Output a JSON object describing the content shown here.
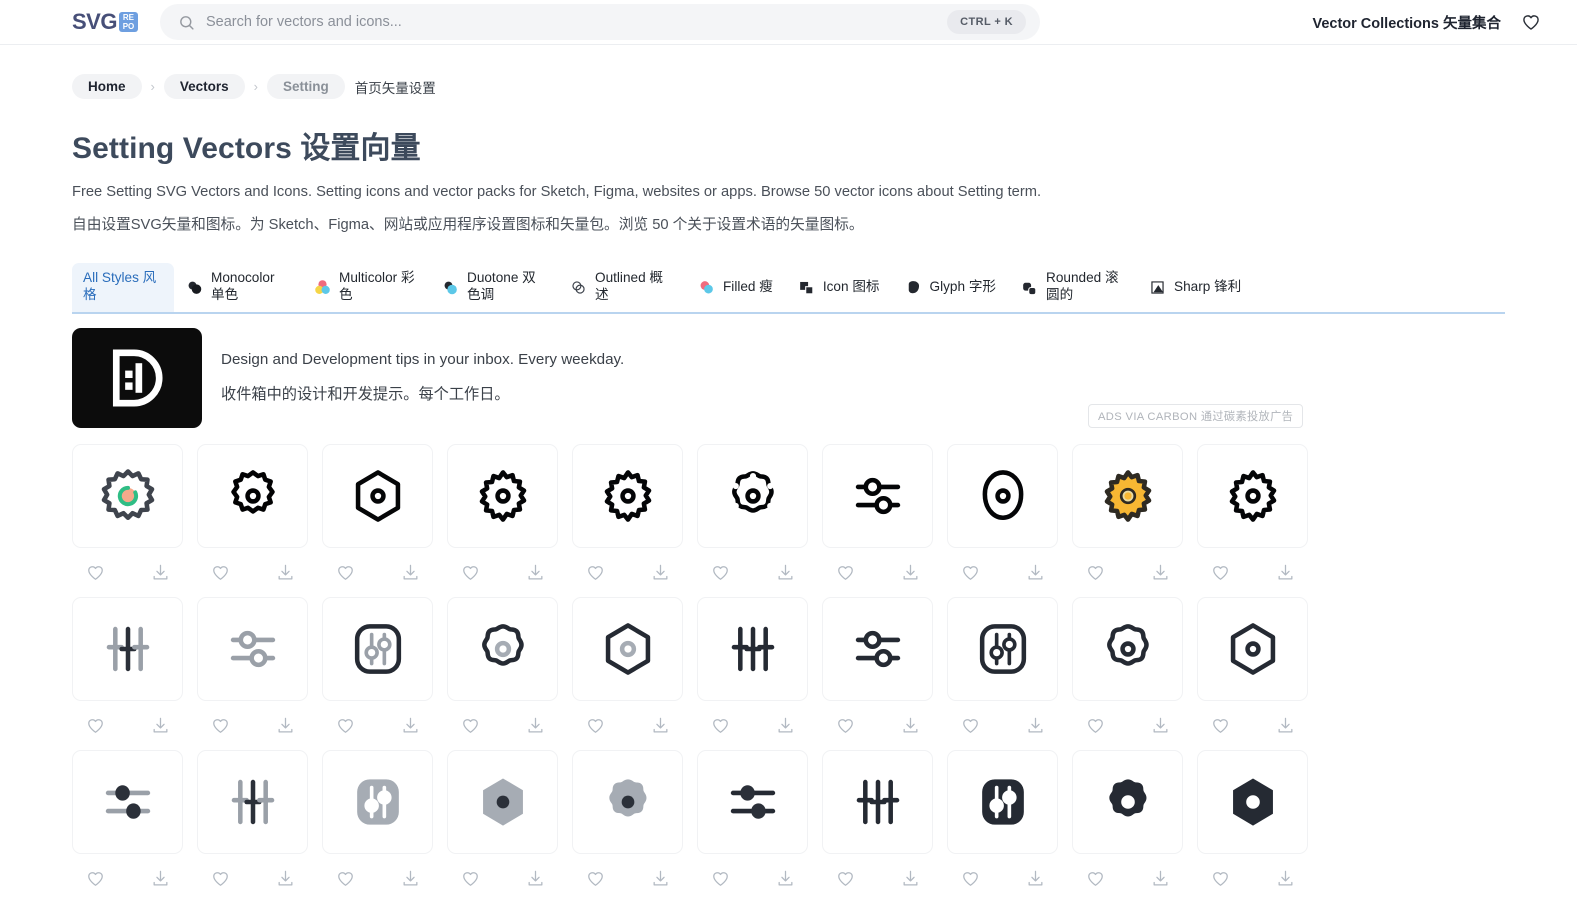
{
  "header": {
    "logo_text": "SVG",
    "logo_badge_top": "RE",
    "logo_badge_bottom": "PO",
    "search_placeholder": "Search for vectors and icons...",
    "search_value": "",
    "shortcut": "CTRL + K",
    "collections_label": "Vector Collections 矢量集合",
    "favorites_icon": "heart-icon",
    "search_icon": "search-icon"
  },
  "breadcrumb": {
    "items": [
      {
        "label": "Home",
        "muted": false
      },
      {
        "label": "Vectors",
        "muted": false
      },
      {
        "label": "Setting",
        "muted": true
      }
    ],
    "separator": "›",
    "trailing_text": "首页矢量设置"
  },
  "page": {
    "title": "Setting Vectors  设置向量",
    "description_en": "Free Setting SVG Vectors and Icons. Setting icons and vector packs for Sketch, Figma, websites or apps. Browse 50 vector icons about Setting term.",
    "description_zh": "自由设置SVG矢量和图标。为 Sketch、Figma、网站或应用程序设置图标和矢量包。浏览 50 个关于设置术语的矢量图标。"
  },
  "tabs": [
    {
      "label": "All Styles 风格",
      "icon": "none",
      "active": true
    },
    {
      "label": "Monocolor 单色",
      "icon": "two-circles-black-icon",
      "active": false
    },
    {
      "label": "Multicolor 彩色",
      "icon": "three-circles-color-icon",
      "active": false
    },
    {
      "label": "Duotone 双色调",
      "icon": "two-circles-duotone-icon",
      "active": false
    },
    {
      "label": "Outlined 概述",
      "icon": "two-circles-outline-icon",
      "active": false
    },
    {
      "label": "Filled 瘦",
      "icon": "two-circles-filled-icon",
      "active": false
    },
    {
      "label": "Icon 图标",
      "icon": "two-squares-icon",
      "active": false
    },
    {
      "label": "Glyph 字形",
      "icon": "blob-glyph-icon",
      "active": false
    },
    {
      "label": "Rounded 滚圆的",
      "icon": "rounded-squares-icon",
      "active": false
    },
    {
      "label": "Sharp 锋利",
      "icon": "sharp-triangle-icon",
      "active": false
    }
  ],
  "ad": {
    "logo_alt": "design-and-development-logo",
    "line_en": "Design and Development tips in your inbox. Every weekday.",
    "line_zh": "收件箱中的设计和开发提示。每个工作日。",
    "badge": "ADS VIA CARBON 通过碳素投放广告"
  },
  "grid": {
    "like_icon": "heart-icon",
    "download_icon": "download-icon",
    "items": [
      {
        "name": "gear-multicolor-badge",
        "shape": "burst-gear",
        "stroke": "#3f444d",
        "fill": "none",
        "center": "multicolor"
      },
      {
        "name": "gear-small-outline",
        "shape": "flower-gear",
        "stroke": "#020203",
        "fill": "none",
        "center": "ring-dark"
      },
      {
        "name": "hexagon-nut-outline",
        "shape": "hexagon",
        "stroke": "#050607",
        "fill": "none",
        "center": "ring-dark"
      },
      {
        "name": "gear-six-tooth-outline",
        "shape": "gear6",
        "stroke": "#040507",
        "fill": "none",
        "center": "ring-dark"
      },
      {
        "name": "gear-six-tooth-outline-2",
        "shape": "gear6",
        "stroke": "#040507",
        "fill": "none",
        "center": "ring-dark"
      },
      {
        "name": "gear-dotted-outline",
        "shape": "gear-dots",
        "stroke": "#040507",
        "fill": "none",
        "center": "ring-dark"
      },
      {
        "name": "sliders-horizontal-outline",
        "shape": "sliders-h",
        "stroke": "#040507",
        "fill": "none",
        "center": "none"
      },
      {
        "name": "nut-circle-outline",
        "shape": "blob",
        "stroke": "#040507",
        "fill": "none",
        "center": "ring-dark"
      },
      {
        "name": "gear-yellow-filled",
        "shape": "gear6",
        "stroke": "#2e2a22",
        "fill": "#f7b733",
        "center": "ring-yellow"
      },
      {
        "name": "gear-six-tooth-bold",
        "shape": "gear6",
        "stroke": "#040507",
        "fill": "none",
        "center": "ring-dark"
      },
      {
        "name": "sliders-vertical-duotone",
        "shape": "sliders-v",
        "stroke": "#9aa0a8",
        "fill": "none",
        "center": "duo"
      },
      {
        "name": "sliders-horizontal-duotone",
        "shape": "sliders-h",
        "stroke": "#9aa0a8",
        "fill": "none",
        "center": "duo"
      },
      {
        "name": "settings-panel-rounded",
        "shape": "panel-sliders",
        "stroke": "#252a33",
        "fill": "none",
        "center": "duo"
      },
      {
        "name": "gear-soft-outline-gray-center",
        "shape": "gear6soft",
        "stroke": "#252a33",
        "fill": "none",
        "center": "ring-gray"
      },
      {
        "name": "hexagon-gray-center",
        "shape": "hexagon",
        "stroke": "#252a33",
        "fill": "none",
        "center": "ring-gray"
      },
      {
        "name": "sliders-vertical-outline",
        "shape": "sliders-v",
        "stroke": "#252a33",
        "fill": "none",
        "center": "mono"
      },
      {
        "name": "sliders-horizontal-outline-2",
        "shape": "sliders-h",
        "stroke": "#252a33",
        "fill": "none",
        "center": "mono"
      },
      {
        "name": "settings-panel-rounded-2",
        "shape": "panel-sliders",
        "stroke": "#252a33",
        "fill": "none",
        "center": "mono"
      },
      {
        "name": "gear-soft-outline",
        "shape": "gear6soft",
        "stroke": "#252a33",
        "fill": "none",
        "center": "ring-dark"
      },
      {
        "name": "hexagon-nut-outline-2",
        "shape": "hexagon",
        "stroke": "#252a33",
        "fill": "none",
        "center": "ring-dark"
      },
      {
        "name": "sliders-horizontal-filled-duotone",
        "shape": "sliders-h",
        "stroke": "#9aa0a8",
        "fill": "solid",
        "center": "duo"
      },
      {
        "name": "sliders-vertical-filled-duotone",
        "shape": "sliders-v",
        "stroke": "#9aa0a8",
        "fill": "solid",
        "center": "duo"
      },
      {
        "name": "settings-panel-filled-gray",
        "shape": "panel-sliders",
        "stroke": "#a6acb4",
        "fill": "solid",
        "center": "duo"
      },
      {
        "name": "hexagon-filled-gray",
        "shape": "hexagon",
        "stroke": "#a6acb4",
        "fill": "solid",
        "center": "dot-dark"
      },
      {
        "name": "gear-filled-gray",
        "shape": "gear6soft",
        "stroke": "#a6acb4",
        "fill": "solid",
        "center": "dot-dark"
      },
      {
        "name": "sliders-horizontal-filled",
        "shape": "sliders-h",
        "stroke": "#252a33",
        "fill": "solid",
        "center": "mono"
      },
      {
        "name": "sliders-vertical-filled",
        "shape": "sliders-v",
        "stroke": "#252a33",
        "fill": "solid",
        "center": "mono"
      },
      {
        "name": "settings-panel-filled",
        "shape": "panel-sliders",
        "stroke": "#252a33",
        "fill": "solid",
        "center": "knockout"
      },
      {
        "name": "gear-filled-dark",
        "shape": "gear6soft",
        "stroke": "#252a33",
        "fill": "solid",
        "center": "knockout"
      },
      {
        "name": "hexagon-filled-dark",
        "shape": "hexagon",
        "stroke": "#252a33",
        "fill": "solid",
        "center": "knockout"
      }
    ]
  }
}
